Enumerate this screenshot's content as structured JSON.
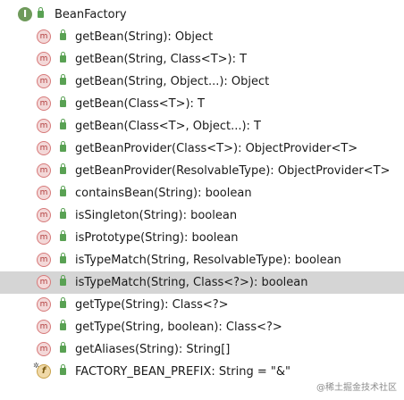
{
  "root": {
    "label": "BeanFactory",
    "icon": "interface-icon",
    "icon_letter": "I"
  },
  "members": [
    {
      "label": "getBean(String): Object",
      "kind": "method"
    },
    {
      "label": "getBean(String, Class<T>): T",
      "kind": "method"
    },
    {
      "label": "getBean(String, Object...): Object",
      "kind": "method"
    },
    {
      "label": "getBean(Class<T>): T",
      "kind": "method"
    },
    {
      "label": "getBean(Class<T>, Object...): T",
      "kind": "method"
    },
    {
      "label": "getBeanProvider(Class<T>): ObjectProvider<T>",
      "kind": "method"
    },
    {
      "label": "getBeanProvider(ResolvableType): ObjectProvider<T>",
      "kind": "method"
    },
    {
      "label": "containsBean(String): boolean",
      "kind": "method"
    },
    {
      "label": "isSingleton(String): boolean",
      "kind": "method"
    },
    {
      "label": "isPrototype(String): boolean",
      "kind": "method"
    },
    {
      "label": "isTypeMatch(String, ResolvableType): boolean",
      "kind": "method"
    },
    {
      "label": "isTypeMatch(String, Class<?>): boolean",
      "kind": "method",
      "selected": true
    },
    {
      "label": "getType(String): Class<?>",
      "kind": "method"
    },
    {
      "label": "getType(String, boolean): Class<?>",
      "kind": "method"
    },
    {
      "label": "getAliases(String): String[]",
      "kind": "method"
    },
    {
      "label": "FACTORY_BEAN_PREFIX: String = \"&\"",
      "kind": "field"
    }
  ],
  "icon_letters": {
    "method": "m",
    "field": "f"
  },
  "colors": {
    "selected_row": "#d5d5d5",
    "lock": "#59a153",
    "interface_icon": "#6f9a5b",
    "method_icon_bg": "#f3d8d8",
    "field_icon_bg": "#f0d9a8"
  },
  "watermark": "@稀土掘金技术社区"
}
